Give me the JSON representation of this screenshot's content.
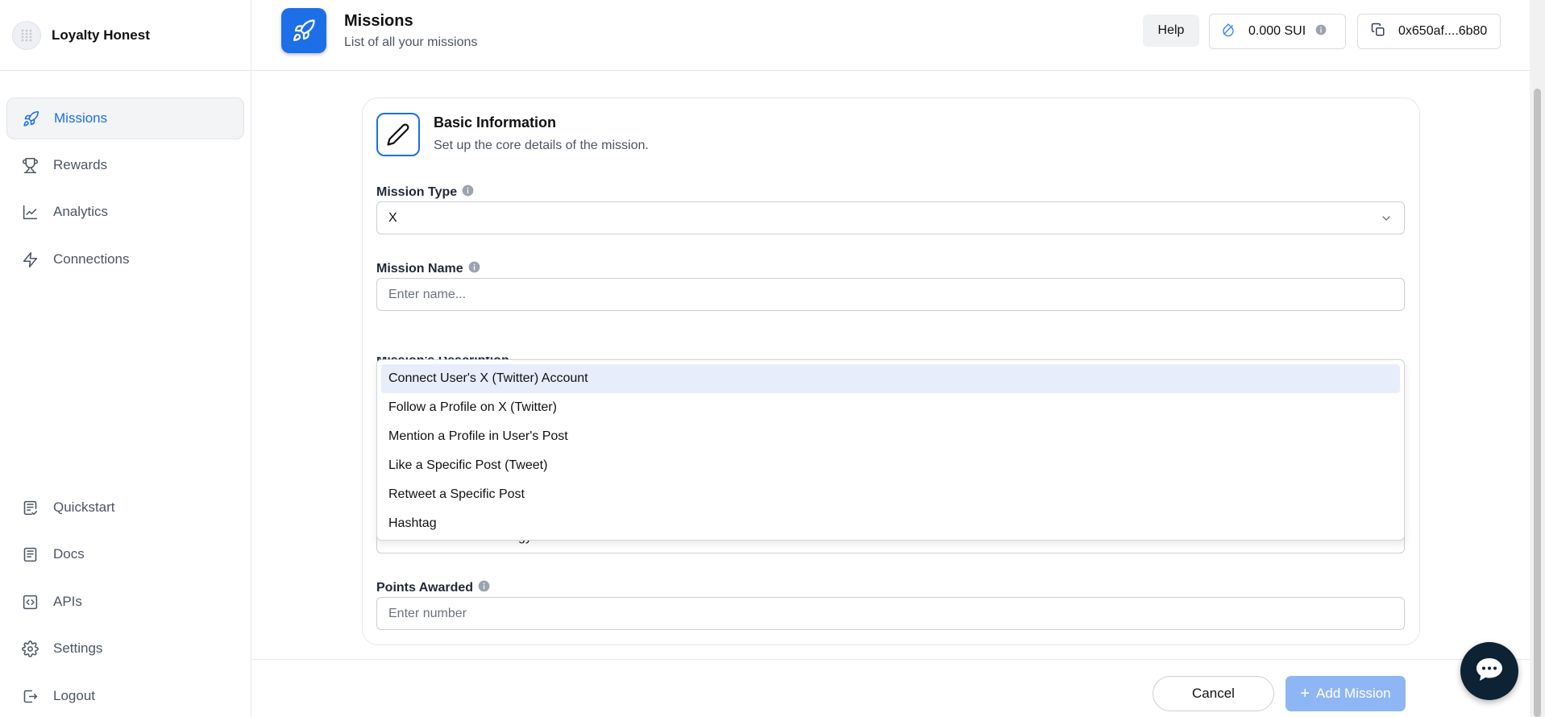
{
  "brand": {
    "name": "Loyalty Honest"
  },
  "sidebar": {
    "top_items": [
      {
        "label": "Missions",
        "icon": "rocket-icon",
        "active": true
      },
      {
        "label": "Rewards",
        "icon": "trophy-icon"
      },
      {
        "label": "Analytics",
        "icon": "line-chart-icon"
      },
      {
        "label": "Connections",
        "icon": "lightning-icon"
      }
    ],
    "bottom_items": [
      {
        "label": "Quickstart",
        "icon": "checklist-icon"
      },
      {
        "label": "Docs",
        "icon": "document-icon"
      },
      {
        "label": "APIs",
        "icon": "code-icon"
      },
      {
        "label": "Settings",
        "icon": "gear-icon"
      },
      {
        "label": "Logout",
        "icon": "logout-icon"
      }
    ]
  },
  "header": {
    "title": "Missions",
    "subtitle": "List of all your missions",
    "help_label": "Help",
    "balance": "0.000 SUI",
    "wallet_address": "0x650af....6b80"
  },
  "form": {
    "section_title": "Basic Information",
    "section_subtitle": "Set up the core details of the mission.",
    "mission_type": {
      "label": "Mission Type",
      "value": "X"
    },
    "mission_name": {
      "label": "Mission Name",
      "placeholder": "Enter name..."
    },
    "mission_description": {
      "label": "Mission's Description"
    },
    "mission_strategy": {
      "placeholder": "Select a mission strategy"
    },
    "points_awarded": {
      "label": "Points Awarded",
      "placeholder": "Enter number"
    }
  },
  "strategy_dropdown": {
    "options": [
      "Connect User's X (Twitter) Account",
      "Follow a Profile on X (Twitter)",
      "Mention a Profile in User's Post",
      "Like a Specific Post (Tweet)",
      "Retweet a Specific Post",
      "Hashtag"
    ],
    "highlighted_index": 0
  },
  "footer": {
    "cancel_label": "Cancel",
    "add_label": "Add Mission"
  },
  "colors": {
    "accent": "#1d6fe8",
    "add_button_disabled": "#8fb6f4",
    "highlight": "#e8edfb",
    "chat_bubble": "#0d2233"
  }
}
